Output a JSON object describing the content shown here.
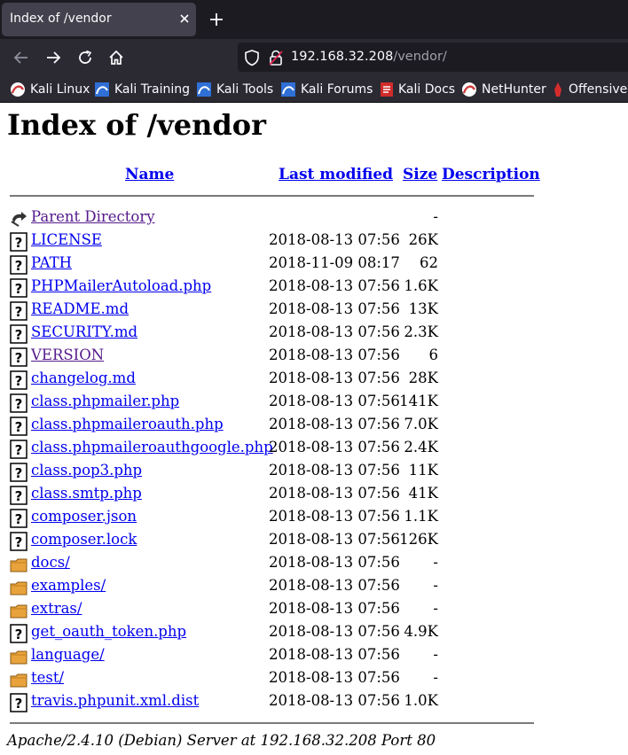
{
  "browser": {
    "tab_title": "Index of /vendor",
    "url_host": "192.168.32.208",
    "url_path": "/vendor/",
    "bookmarks": [
      {
        "label": "Kali Linux",
        "icon": "kali-icon"
      },
      {
        "label": "Kali Training",
        "icon": "kali-training-icon"
      },
      {
        "label": "Kali Tools",
        "icon": "kali-tools-icon"
      },
      {
        "label": "Kali Forums",
        "icon": "kali-forums-icon"
      },
      {
        "label": "Kali Docs",
        "icon": "kali-docs-icon"
      },
      {
        "label": "NetHunter",
        "icon": "nethunter-icon"
      },
      {
        "label": "Offensive",
        "icon": "offensive-icon"
      }
    ]
  },
  "page": {
    "title": "Index of /vendor",
    "columns": {
      "name": "Name",
      "last_modified": "Last modified",
      "size": "Size",
      "description": "Description"
    },
    "entries": [
      {
        "name": "Parent Directory",
        "date": "",
        "size": "-",
        "type": "parent",
        "visited": true
      },
      {
        "name": "LICENSE",
        "date": "2018-08-13 07:56",
        "size": "26K",
        "type": "file",
        "visited": false
      },
      {
        "name": "PATH",
        "date": "2018-11-09 08:17",
        "size": "62",
        "type": "file",
        "visited": false
      },
      {
        "name": "PHPMailerAutoload.php",
        "date": "2018-08-13 07:56",
        "size": "1.6K",
        "type": "file",
        "visited": false
      },
      {
        "name": "README.md",
        "date": "2018-08-13 07:56",
        "size": "13K",
        "type": "file",
        "visited": false
      },
      {
        "name": "SECURITY.md",
        "date": "2018-08-13 07:56",
        "size": "2.3K",
        "type": "file",
        "visited": false
      },
      {
        "name": "VERSION",
        "date": "2018-08-13 07:56",
        "size": "6",
        "type": "file",
        "visited": true
      },
      {
        "name": "changelog.md",
        "date": "2018-08-13 07:56",
        "size": "28K",
        "type": "file",
        "visited": false
      },
      {
        "name": "class.phpmailer.php",
        "date": "2018-08-13 07:56",
        "size": "141K",
        "type": "file",
        "visited": false
      },
      {
        "name": "class.phpmaileroauth.php",
        "date": "2018-08-13 07:56",
        "size": "7.0K",
        "type": "file",
        "visited": false
      },
      {
        "name": "class.phpmaileroauthgoogle.php",
        "date": "2018-08-13 07:56",
        "size": "2.4K",
        "type": "file",
        "visited": false
      },
      {
        "name": "class.pop3.php",
        "date": "2018-08-13 07:56",
        "size": "11K",
        "type": "file",
        "visited": false
      },
      {
        "name": "class.smtp.php",
        "date": "2018-08-13 07:56",
        "size": "41K",
        "type": "file",
        "visited": false
      },
      {
        "name": "composer.json",
        "date": "2018-08-13 07:56",
        "size": "1.1K",
        "type": "file",
        "visited": false
      },
      {
        "name": "composer.lock",
        "date": "2018-08-13 07:56",
        "size": "126K",
        "type": "file",
        "visited": false
      },
      {
        "name": "docs/",
        "date": "2018-08-13 07:56",
        "size": "-",
        "type": "folder",
        "visited": false
      },
      {
        "name": "examples/",
        "date": "2018-08-13 07:56",
        "size": "-",
        "type": "folder",
        "visited": false
      },
      {
        "name": "extras/",
        "date": "2018-08-13 07:56",
        "size": "-",
        "type": "folder",
        "visited": false
      },
      {
        "name": "get_oauth_token.php",
        "date": "2018-08-13 07:56",
        "size": "4.9K",
        "type": "file",
        "visited": false
      },
      {
        "name": "language/",
        "date": "2018-08-13 07:56",
        "size": "-",
        "type": "folder",
        "visited": false
      },
      {
        "name": "test/",
        "date": "2018-08-13 07:56",
        "size": "-",
        "type": "folder",
        "visited": false
      },
      {
        "name": "travis.phpunit.xml.dist",
        "date": "2018-08-13 07:56",
        "size": "1.0K",
        "type": "file",
        "visited": false
      }
    ],
    "footer": "Apache/2.4.10 (Debian) Server at 192.168.32.208 Port 80"
  }
}
